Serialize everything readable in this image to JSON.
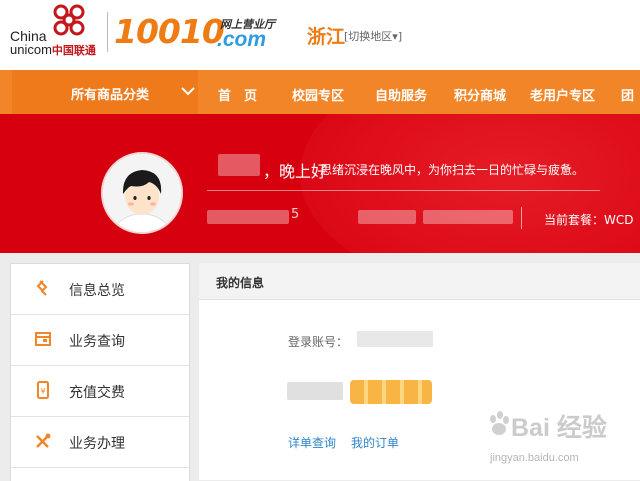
{
  "header": {
    "logo_text_top": "China",
    "logo_text_bottom": "unicom",
    "logo_text_cn": "中国联通",
    "brand_number": "10010",
    "brand_subtitle": "网上营业厅",
    "brand_domain": ".com",
    "region": "浙江",
    "region_switch": "[切换地区▾]"
  },
  "nav": {
    "category_label": "所有商品分类",
    "items": [
      "首　页",
      "校园专区",
      "自助服务",
      "积分商城",
      "老用户专区",
      "团"
    ]
  },
  "hero": {
    "greeting": "，晚上好",
    "message": "思绪沉浸在晚风中，为你扫去一日的忙碌与疲惫。",
    "phone_tail": "5",
    "plan_label": "当前套餐：WCD"
  },
  "sidebar": {
    "items": [
      {
        "label": "信息总览",
        "icon": "overview-icon"
      },
      {
        "label": "业务查询",
        "icon": "query-icon"
      },
      {
        "label": "充值交费",
        "icon": "recharge-icon"
      },
      {
        "label": "业务办理",
        "icon": "tools-icon"
      }
    ]
  },
  "panel": {
    "title": "我的信息",
    "account_label": "登录账号：",
    "links": [
      "详单查询",
      "我的订单"
    ]
  },
  "watermark": {
    "text": "Bai 经验",
    "url": "jingyan.baidu.com"
  },
  "colors": {
    "brand_orange": "#ef7b14",
    "nav_orange": "#f18527",
    "hero_red": "#d7000f",
    "link_blue": "#2f86c9",
    "domain_blue": "#2f9be0"
  }
}
